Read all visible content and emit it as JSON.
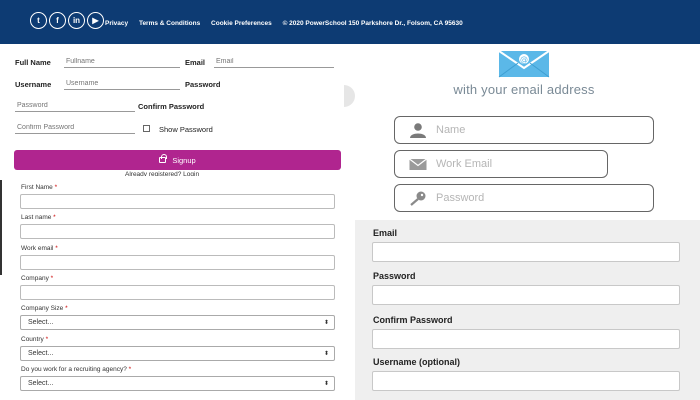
{
  "topbar": {
    "social": [
      "twitter-icon",
      "facebook-icon",
      "linkedin-icon",
      "youtube-icon"
    ],
    "social_glyphs": [
      "t",
      "f",
      "in",
      "▶"
    ],
    "links": [
      "Privacy",
      "Terms & Conditions",
      "Cookie Preferences"
    ],
    "copyright": "© 2020 PowerSchool 150 Parkshore Dr., Folsom, CA 95630"
  },
  "signup_form": {
    "fullname_label": "Full Name",
    "fullname_placeholder": "Fullname",
    "email_label": "Email",
    "email_placeholder": "Email",
    "username_label": "Username",
    "username_placeholder": "Username",
    "password_label": "Password",
    "password_placeholder": "Password",
    "confirm_label": "Confirm Password",
    "confirm_placeholder": "Confirm Password",
    "show_password": "Show Password",
    "signup_button": "Signup",
    "already": "Already registered? Login"
  },
  "lead_form": {
    "first_name": "First Name",
    "last_name": "Last name",
    "work_email": "Work email",
    "company": "Company",
    "company_size": "Company Size",
    "company_size_value": "Select...",
    "country": "Country",
    "country_value": "Select...",
    "recruiting": "Do you work for a recruiting agency?",
    "recruiting_value": "Select...",
    "required_mark": "*"
  },
  "email_signup": {
    "heading": "with your email address",
    "name_placeholder": "Name",
    "work_email_placeholder": "Work Email",
    "password_placeholder": "Password",
    "accent": "#5bb8e8"
  },
  "account_form": {
    "email_label": "Email",
    "password_label": "Password",
    "confirm_label": "Confirm Password",
    "username_label": "Username (optional)"
  },
  "colors": {
    "topbar": "#0d3b73",
    "signup_button": "#b0258f",
    "gray_panel": "#efefef"
  }
}
